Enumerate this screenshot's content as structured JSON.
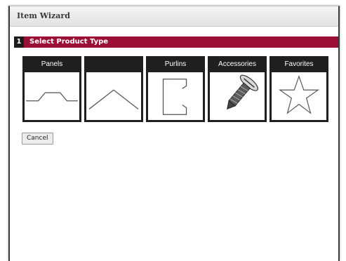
{
  "window": {
    "title": "Item Wizard"
  },
  "step": {
    "number": "1",
    "title": "Select Product Type"
  },
  "tiles": [
    {
      "label": "Panels",
      "icon": "panel-profile-icon"
    },
    {
      "label": "",
      "icon": "roof-ridge-profile-icon"
    },
    {
      "label": "Purlins",
      "icon": "purlin-profile-icon"
    },
    {
      "label": "Accessories",
      "icon": "screw-icon"
    },
    {
      "label": "Favorites",
      "icon": "star-icon"
    }
  ],
  "buttons": {
    "cancel": "Cancel"
  },
  "colors": {
    "step_bar": "#9b0f36",
    "tile_header": "#1f1f1f",
    "titlebar": "#e8e8e8"
  }
}
